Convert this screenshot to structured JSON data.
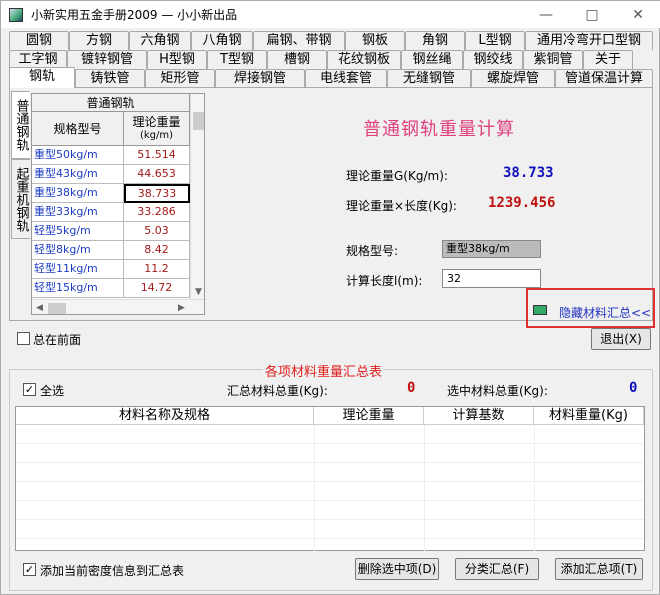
{
  "window": {
    "title": "小新实用五金手册2009 — 小小新出品"
  },
  "tabs_row1": [
    "圆钢",
    "方钢",
    "六角钢",
    "八角钢",
    "扁钢、带钢",
    "钢板",
    "角钢",
    "L型钢",
    "通用冷弯开口型钢"
  ],
  "tabs_row2": [
    "工字钢",
    "镀锌钢管",
    "H型钢",
    "T型钢",
    "槽钢",
    "花纹钢板",
    "钢丝绳",
    "钢绞线",
    "紫铜管",
    "关于"
  ],
  "tabs_row3": [
    "钢轨",
    "铸铁管",
    "矩形管",
    "焊接钢管",
    "电线套管",
    "无缝钢管",
    "螺旋焊管",
    "管道保温计算"
  ],
  "side_tabs": [
    "普通钢轨",
    "起重机钢轨"
  ],
  "grid": {
    "caption": "普通钢轨",
    "col1": "规格型号",
    "col2_line1": "理论重量",
    "col2_line2": "(kg/m)",
    "rows": [
      {
        "name": "重型50kg/m",
        "weight": "51.514"
      },
      {
        "name": "重型43kg/m",
        "weight": "44.653"
      },
      {
        "name": "重型38kg/m",
        "weight": "38.733"
      },
      {
        "name": "重型33kg/m",
        "weight": "33.286"
      },
      {
        "name": "轻型5kg/m",
        "weight": "5.03"
      },
      {
        "name": "轻型8kg/m",
        "weight": "8.42"
      },
      {
        "name": "轻型11kg/m",
        "weight": "11.2"
      },
      {
        "name": "轻型15kg/m",
        "weight": "14.72"
      }
    ]
  },
  "calc": {
    "title": "普通钢轨重量计算",
    "weight_label": "理论重量G(Kg/m):",
    "weight_value": "38.733",
    "total_label": "理论重量×长度(Kg):",
    "total_value": "1239.456",
    "spec_label": "规格型号:",
    "spec_value": "重型38kg/m",
    "length_label": "计算长度l(m):",
    "length_value": "32",
    "hide_link": "隐藏材料汇总<<"
  },
  "controls": {
    "always_on_top": "总在前面",
    "exit": "退出(X)"
  },
  "summary": {
    "title": "各项材料重量汇总表",
    "select_all": "全选",
    "total_label": "汇总材料总重(Kg):",
    "total_value": "0",
    "selected_label": "选中材料总重(Kg):",
    "selected_value": "0",
    "columns": [
      "材料名称及规格",
      "理论重量",
      "计算基数",
      "材料重量(Kg)"
    ],
    "add_density": "添加当前密度信息到汇总表",
    "delete_btn": "删除选中项(D)",
    "classify_btn": "分类汇总(F)",
    "add_btn": "添加汇总项(T)"
  },
  "colors": {
    "title_pink": "#e0427e",
    "value_blue": "#1010c0",
    "value_red": "#c01010",
    "highlight_red": "#e03030"
  }
}
